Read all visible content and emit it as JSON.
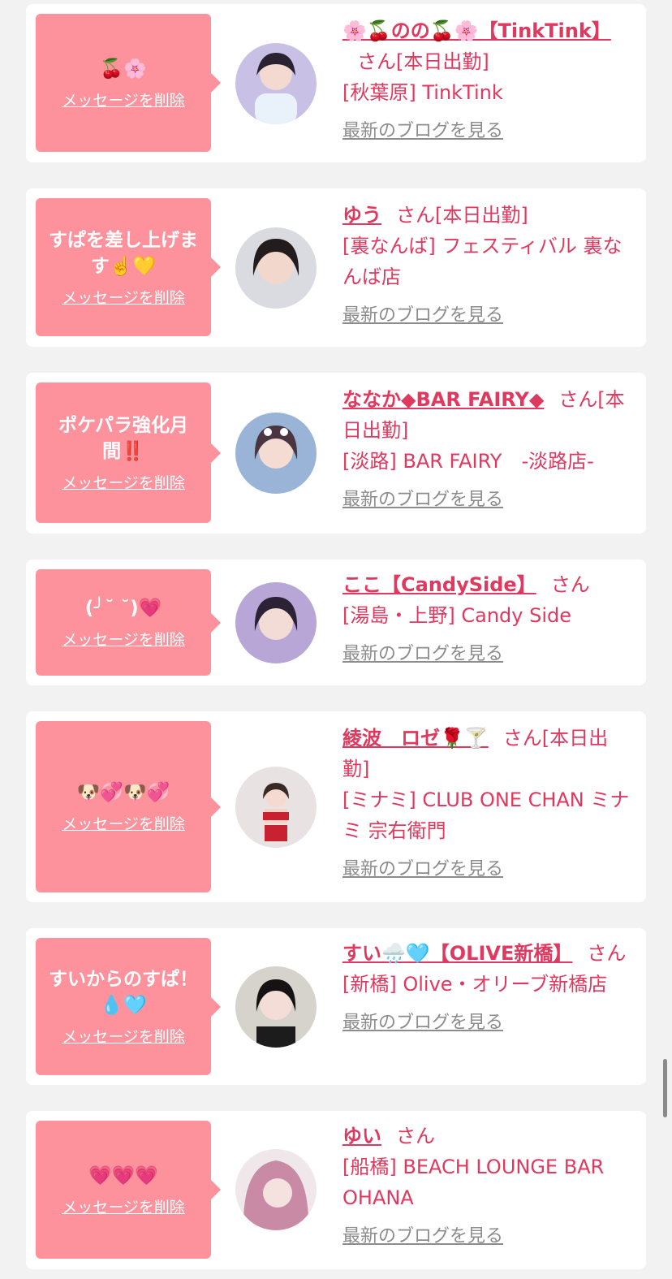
{
  "cards": [
    {
      "message": "🍒🌸",
      "delete_label": "メッセージを削除",
      "name": "🌸🍒のの🍒🌸【TinkTink】",
      "suffix": "さん[本日出勤]",
      "shop": "[秋葉原] TinkTink",
      "blog_label": "最新のブログを見る"
    },
    {
      "message": "すぱを差し上げます☝️💛",
      "delete_label": "メッセージを削除",
      "name": "ゆう",
      "suffix": "さん[本日出勤]",
      "shop": "[裏なんば] フェスティバル 裏なんば店",
      "blog_label": "最新のブログを見る"
    },
    {
      "message": "ポケパラ強化月間‼️",
      "delete_label": "メッセージを削除",
      "name": "ななか◆BAR FAIRY◆",
      "suffix": "さん[本日出勤]",
      "shop": "[淡路] BAR FAIRY　-淡路店-",
      "blog_label": "最新のブログを見る"
    },
    {
      "message": "(╯˘ ˘)💗",
      "delete_label": "メッセージを削除",
      "name": "ここ【CandySide】",
      "suffix": "さん",
      "shop": "[湯島・上野] Candy Side",
      "blog_label": "最新のブログを見る"
    },
    {
      "message": "🐶💞🐶💞",
      "delete_label": "メッセージを削除",
      "name": "綾波　ロゼ🌹🍸",
      "suffix": "さん[本日出勤]",
      "shop": "[ミナミ] CLUB ONE CHAN ミナミ 宗右衛門",
      "blog_label": "最新のブログを見る"
    },
    {
      "message": "すいからのすぱ！💧🩵",
      "delete_label": "メッセージを削除",
      "name": "すい🌧️🩵【OLIVE新橋】",
      "suffix": "さん",
      "shop": "[新橋] Olive・オリーブ新橋店",
      "blog_label": "最新のブログを見る"
    },
    {
      "message": "💗💗💗",
      "delete_label": "メッセージを削除",
      "name": "ゆい",
      "suffix": "さん",
      "shop": "[船橋] BEACH LOUNGE BAR OHANA",
      "blog_label": "最新のブログを見る"
    }
  ],
  "colors": {
    "bubble": "#fd919c",
    "accent": "#e0395f",
    "link_gray": "#8c8c8c",
    "background": "#f2f2f2"
  }
}
